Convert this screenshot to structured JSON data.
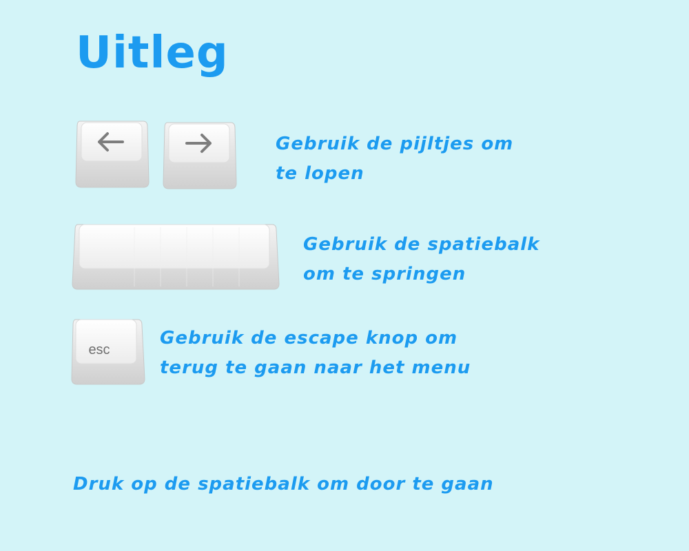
{
  "title": "Uitleg",
  "instructions": {
    "arrows": {
      "line1": "Gebruik de pijltjes om",
      "line2": "te lopen"
    },
    "space": {
      "line1": "Gebruik de spatiebalk",
      "line2": "om te springen"
    },
    "escape": {
      "line1": "Gebruik de escape knop om",
      "line2": "terug te gaan naar het menu"
    }
  },
  "keys": {
    "left_arrow": "arrow-left-icon",
    "right_arrow": "arrow-right-icon",
    "space": "spacebar",
    "esc_label": "esc"
  },
  "footer": "Druk op de spatiebalk om door te gaan",
  "colors": {
    "background": "#d3f4f8",
    "text": "#1c9bf0"
  }
}
